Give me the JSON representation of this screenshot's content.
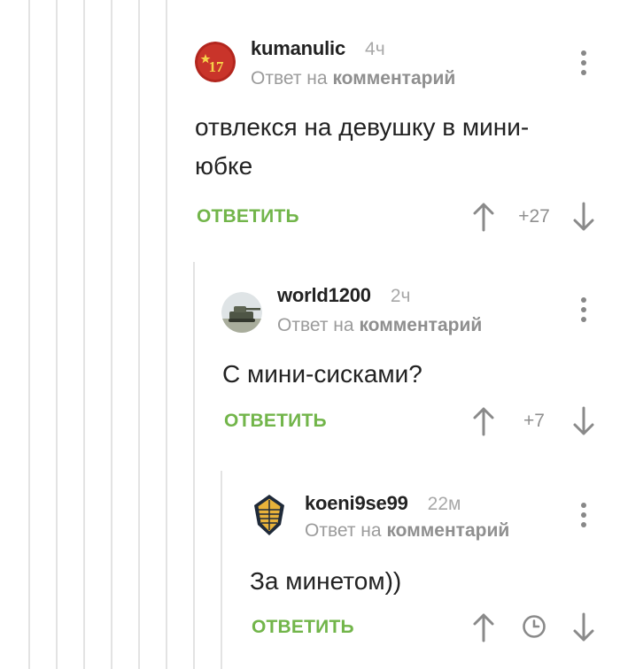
{
  "comments": [
    {
      "username": "kumanulic",
      "time": "4ч",
      "reply_prefix": "Ответ на",
      "reply_target": "комментарий",
      "text": "отвлекся на девушку в мини-юбке",
      "reply_label": "ОТВЕТИТЬ",
      "rating": "+27",
      "avatar_label": "17"
    },
    {
      "username": "world1200",
      "time": "2ч",
      "reply_prefix": "Ответ на",
      "reply_target": "комментарий",
      "text": "С мини-сисками?",
      "reply_label": "ОТВЕТИТЬ",
      "rating": "+7"
    },
    {
      "username": "koeni9se99",
      "time": "22м",
      "reply_prefix": "Ответ на",
      "reply_target": "комментарий",
      "text": "За минетом))",
      "reply_label": "ОТВЕТИТЬ"
    }
  ],
  "colors": {
    "accent_green": "#72b54a",
    "thread_line": "#e3e3e3",
    "muted_text": "#9b9b9b"
  },
  "icons": [
    "kebab-menu-icon",
    "upvote-arrow-icon",
    "downvote-arrow-icon",
    "clock-icon"
  ]
}
